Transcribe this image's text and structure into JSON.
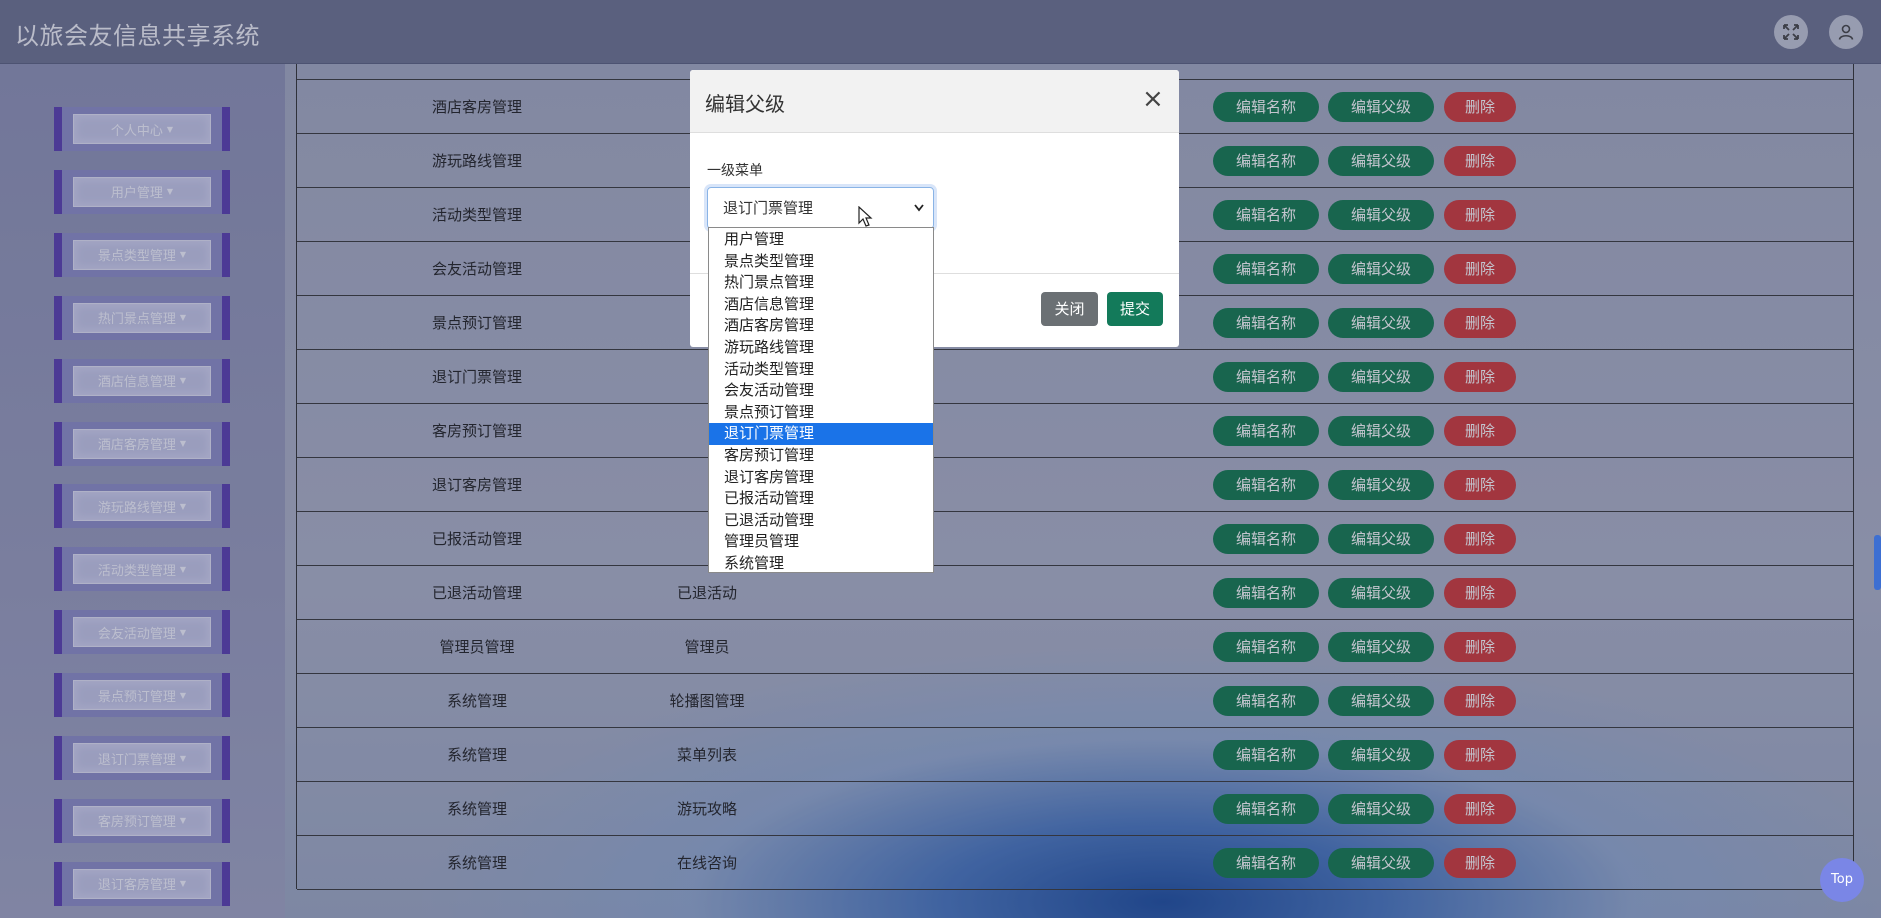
{
  "header": {
    "title": "以旅会友信息共享系统",
    "icons": [
      "fullscreen-icon",
      "user-icon"
    ]
  },
  "sidebar": {
    "items": [
      {
        "label": "个人中心"
      },
      {
        "label": "用户管理"
      },
      {
        "label": "景点类型管理"
      },
      {
        "label": "热门景点管理"
      },
      {
        "label": "酒店信息管理"
      },
      {
        "label": "酒店客房管理"
      },
      {
        "label": "游玩路线管理"
      },
      {
        "label": "活动类型管理"
      },
      {
        "label": "会友活动管理"
      },
      {
        "label": "景点预订管理"
      },
      {
        "label": "退订门票管理"
      },
      {
        "label": "客房预订管理"
      },
      {
        "label": "退订客房管理"
      }
    ]
  },
  "table": {
    "rows": [
      {
        "parent": "酒店客房管理",
        "name": ""
      },
      {
        "parent": "游玩路线管理",
        "name": ""
      },
      {
        "parent": "活动类型管理",
        "name": ""
      },
      {
        "parent": "会友活动管理",
        "name": ""
      },
      {
        "parent": "景点预订管理",
        "name": ""
      },
      {
        "parent": "退订门票管理",
        "name": ""
      },
      {
        "parent": "客房预订管理",
        "name": ""
      },
      {
        "parent": "退订客房管理",
        "name": ""
      },
      {
        "parent": "已报活动管理",
        "name": ""
      },
      {
        "parent": "已退活动管理",
        "name": "已退活动"
      },
      {
        "parent": "管理员管理",
        "name": "管理员"
      },
      {
        "parent": "系统管理",
        "name": "轮播图管理"
      },
      {
        "parent": "系统管理",
        "name": "菜单列表"
      },
      {
        "parent": "系统管理",
        "name": "游玩攻略"
      },
      {
        "parent": "系统管理",
        "name": "在线咨询"
      }
    ],
    "actions": {
      "edit_name": "编辑名称",
      "edit_parent": "编辑父级",
      "delete": "删除"
    },
    "colors": {
      "green": "#137a4e",
      "red": "#d23a3a"
    }
  },
  "modal": {
    "title": "编辑父级",
    "close_symbol": "×",
    "field_label": "一级菜单",
    "selected": "退订门票管理",
    "arrow": "⌄",
    "close_label": "关闭",
    "submit_label": "提交",
    "options": [
      "用户管理",
      "景点类型管理",
      "热门景点管理",
      "酒店信息管理",
      "酒店客房管理",
      "游玩路线管理",
      "活动类型管理",
      "会友活动管理",
      "景点预订管理",
      "退订门票管理",
      "客房预订管理",
      "退订客房管理",
      "已报活动管理",
      "已退活动管理",
      "管理员管理",
      "系统管理"
    ],
    "selected_index": 9
  },
  "top_button": {
    "label": "Top"
  }
}
